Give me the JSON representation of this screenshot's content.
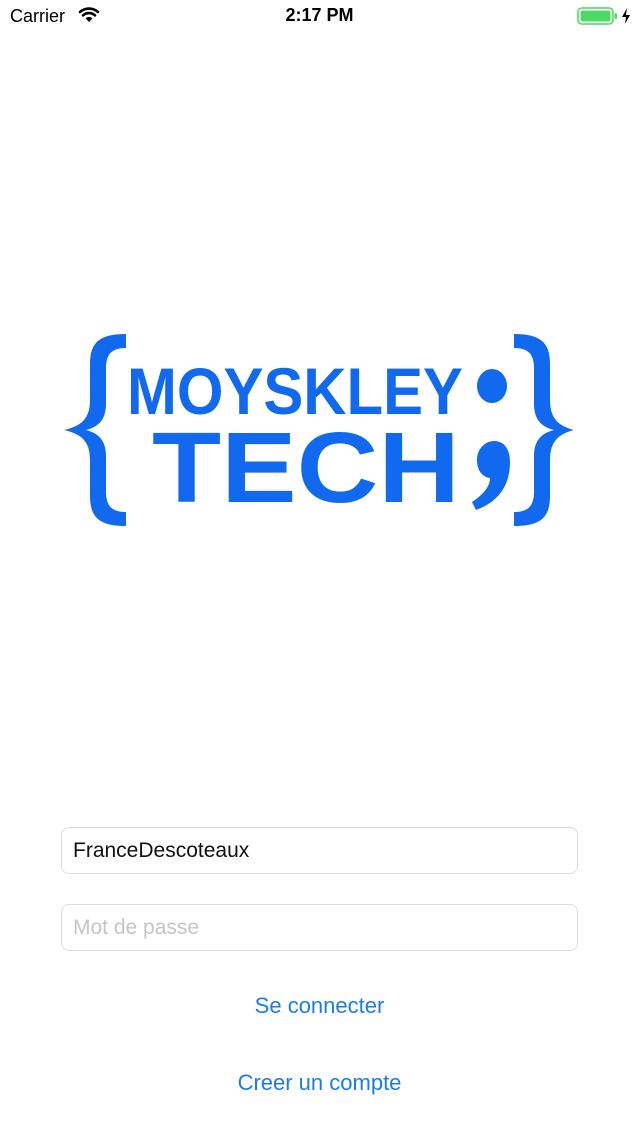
{
  "status_bar": {
    "carrier": "Carrier",
    "time": "2:17 PM",
    "icons": [
      "wifi-icon",
      "battery-icon",
      "charging-bolt-icon"
    ],
    "battery_color": "#4cd964"
  },
  "logo": {
    "line1": "MOYSKLEY",
    "line2": "TECH",
    "color": "#1169f0"
  },
  "form": {
    "username_value": "FranceDescoteaux",
    "password_placeholder": "Mot de passe"
  },
  "actions": {
    "login_label": "Se connecter",
    "create_account_label": "Creer un compte",
    "link_color": "#1a7ee6"
  }
}
